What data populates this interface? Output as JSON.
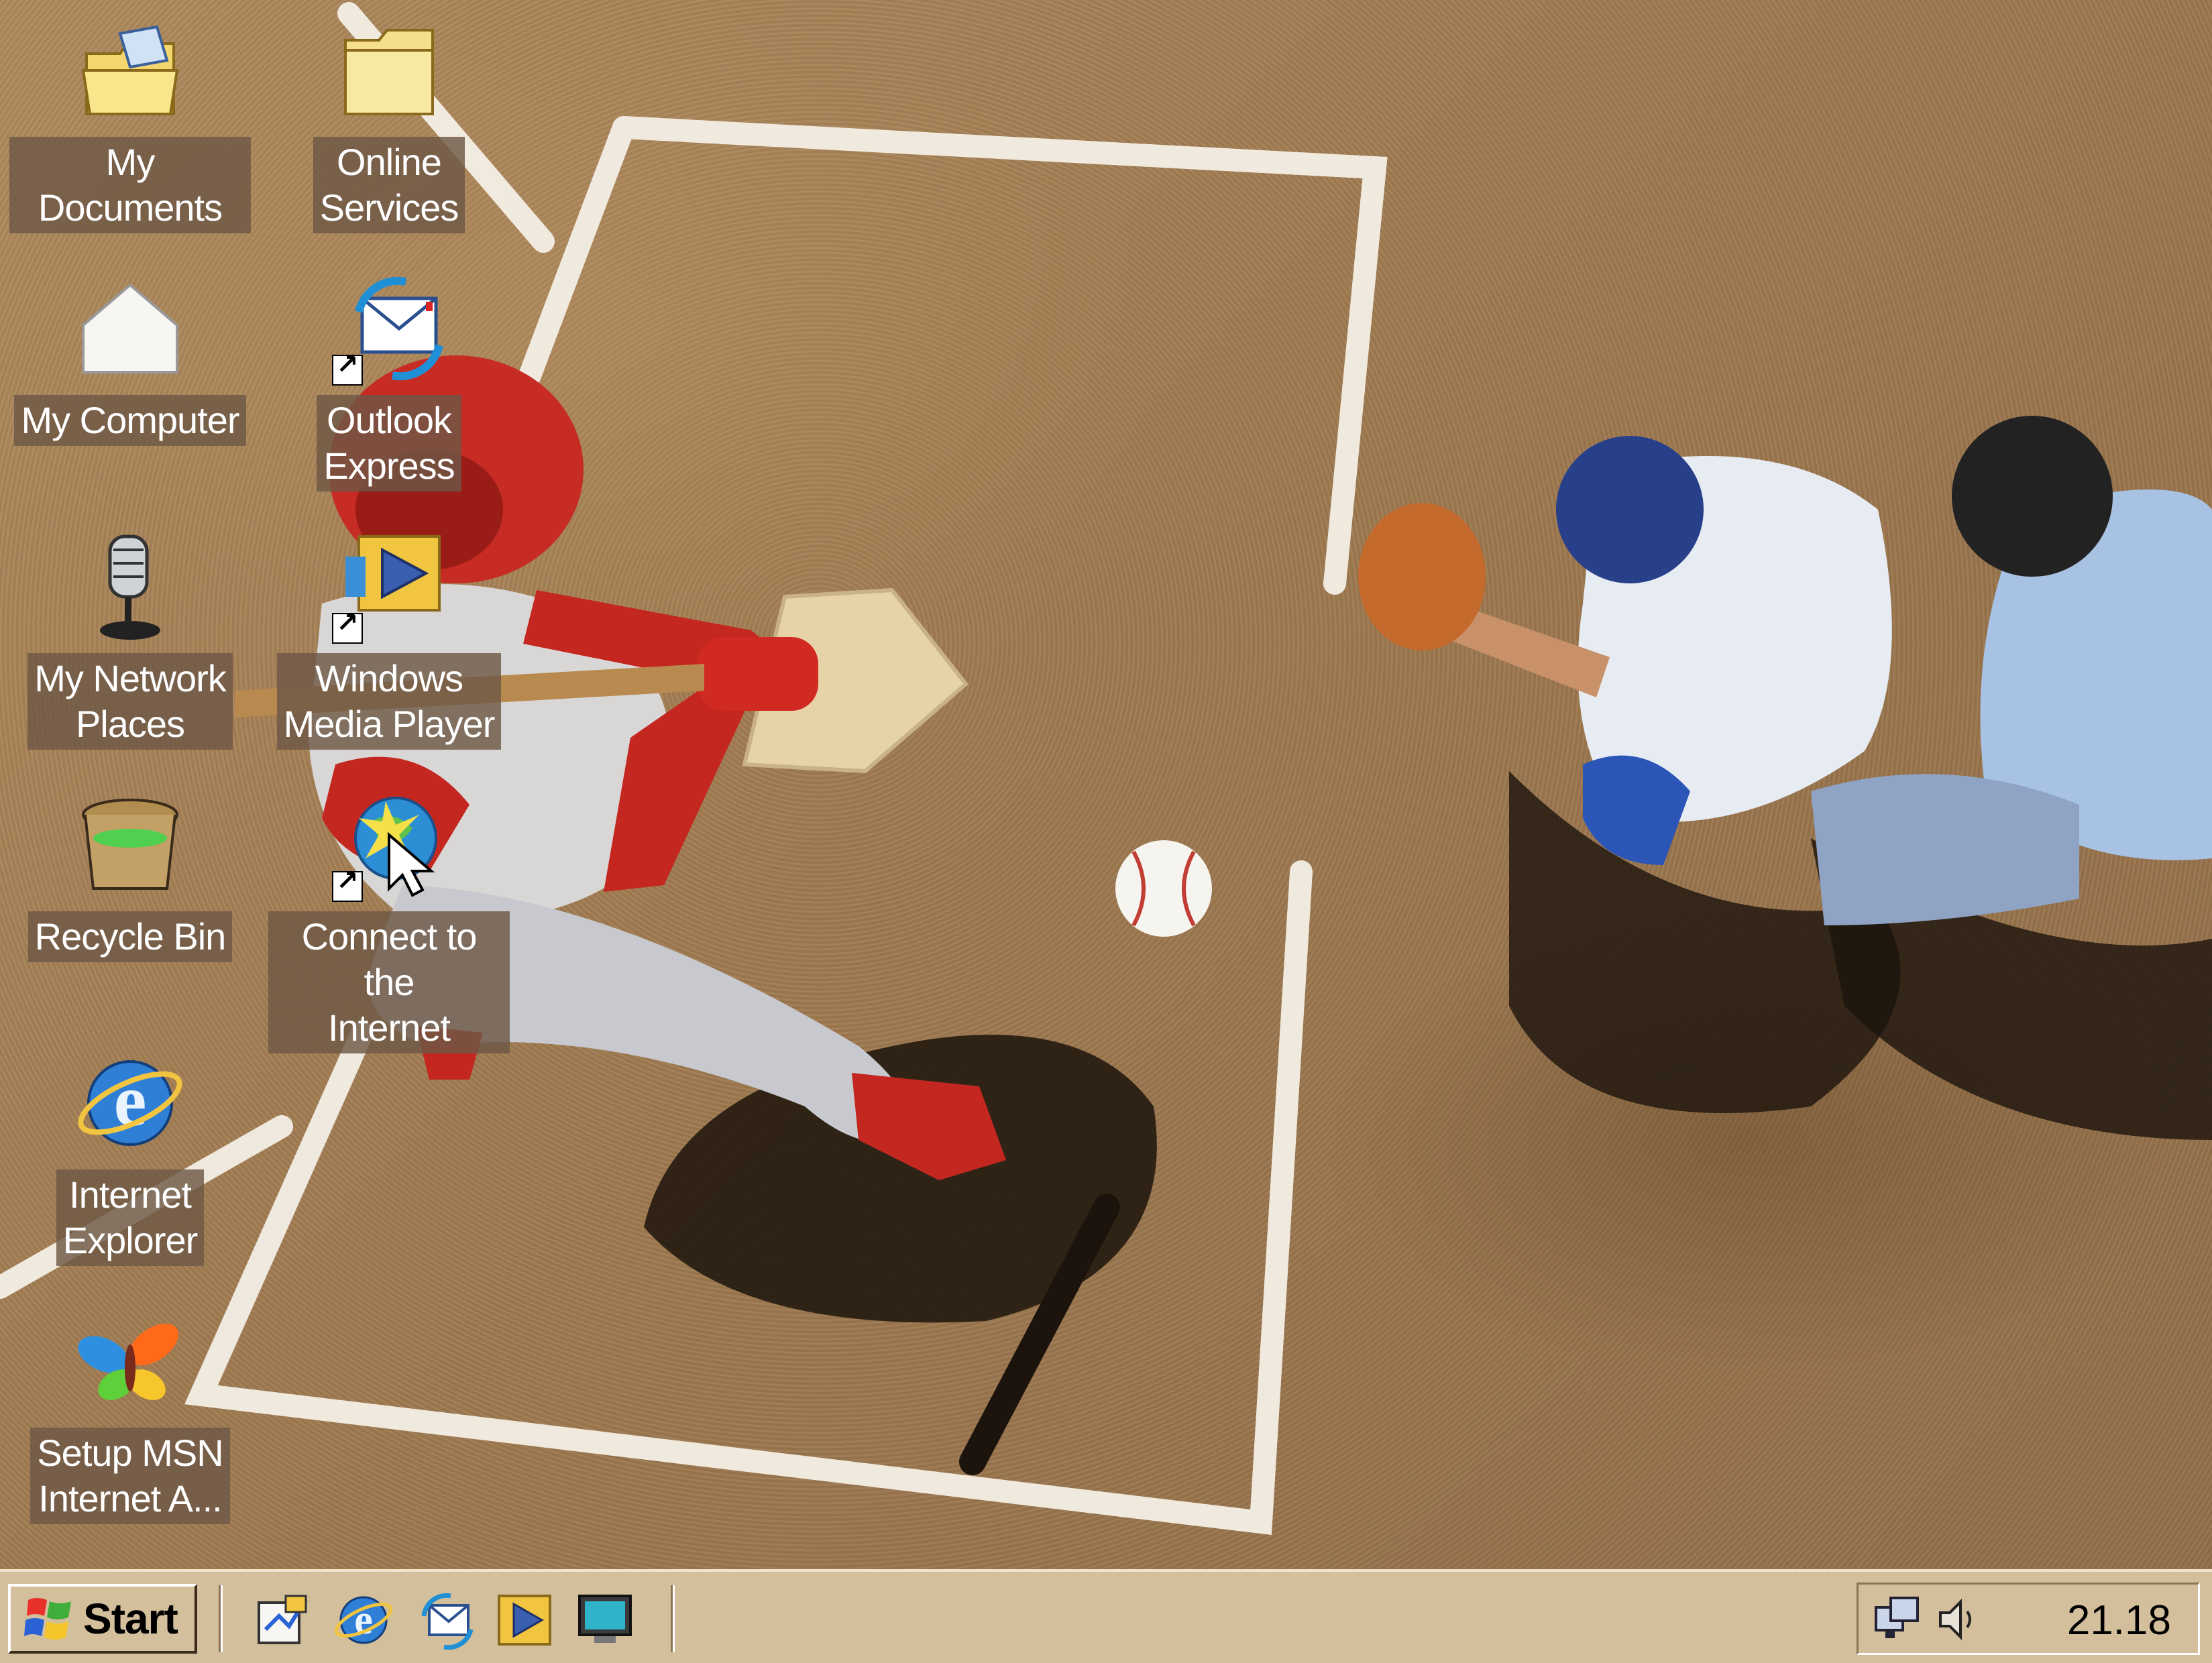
{
  "desktop": {
    "icons": [
      {
        "label": "My Documents",
        "icon": "my-documents-icon"
      },
      {
        "label": "Online\nServices",
        "icon": "folder-icon"
      },
      {
        "label": "My Computer",
        "icon": "my-computer-icon"
      },
      {
        "label": "Outlook\nExpress",
        "icon": "outlook-express-icon"
      },
      {
        "label": "My Network\nPlaces",
        "icon": "network-places-icon"
      },
      {
        "label": "Windows\nMedia Player",
        "icon": "media-player-icon"
      },
      {
        "label": "Recycle Bin",
        "icon": "recycle-bin-icon"
      },
      {
        "label": "Connect to the\nInternet",
        "icon": "connect-internet-icon"
      },
      {
        "label": "Internet\nExplorer",
        "icon": "internet-explorer-icon"
      },
      {
        "label": "Setup MSN\nInternet A...",
        "icon": "msn-butterfly-icon"
      }
    ]
  },
  "taskbar": {
    "start_label": "Start",
    "quick_launch": [
      "show-desktop-icon",
      "internet-explorer-icon",
      "outlook-express-icon",
      "media-player-icon",
      "monitor-icon"
    ],
    "tray_icons": [
      "network-icon",
      "volume-icon"
    ],
    "clock": "21.18"
  },
  "colors": {
    "taskbar": "#d3bf9c",
    "label_bg": "#6e5846",
    "dirt": "#a07b51",
    "chalk": "#f4efe6"
  }
}
